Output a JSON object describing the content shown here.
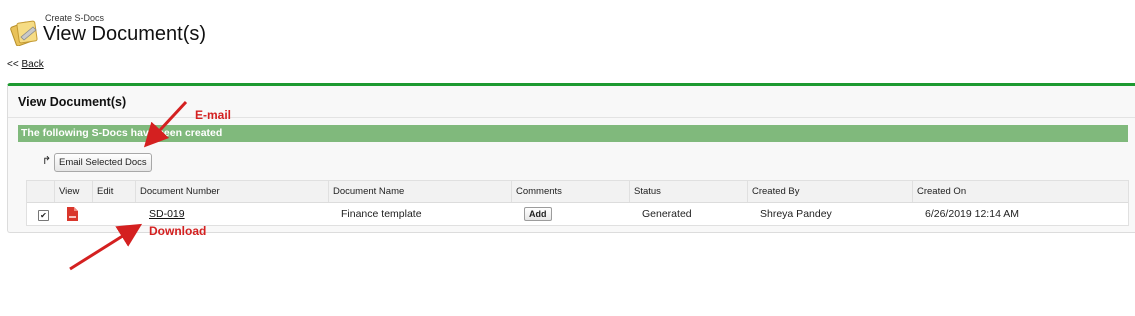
{
  "header": {
    "subtitle": "Create S-Docs",
    "title": "View Document(s)"
  },
  "nav": {
    "back_prefix": "<<",
    "back_label": "Back"
  },
  "section": {
    "title": "View Document(s)",
    "message": "The following S-Docs have been created",
    "email_button": "Email Selected Docs"
  },
  "table": {
    "columns": [
      "View",
      "Edit",
      "Document Number",
      "Document Name",
      "Comments",
      "Status",
      "Created By",
      "Created On"
    ],
    "rows": [
      {
        "selected": true,
        "document_number": "SD-019",
        "document_name": "Finance template",
        "comments_button": "Add",
        "status": "Generated",
        "created_by": "Shreya Pandey",
        "created_on": "6/26/2019 12:14 AM"
      }
    ]
  },
  "annotations": {
    "email_label": "E-mail",
    "download_label": "Download",
    "color": "#d42020"
  },
  "colors": {
    "accent_bar": "#1d9a30",
    "message_bg": "#80b97c"
  },
  "icons": [
    "documents-logo-icon",
    "email-forward-icon",
    "pdf-file-icon",
    "checkbox-checked-icon"
  ]
}
